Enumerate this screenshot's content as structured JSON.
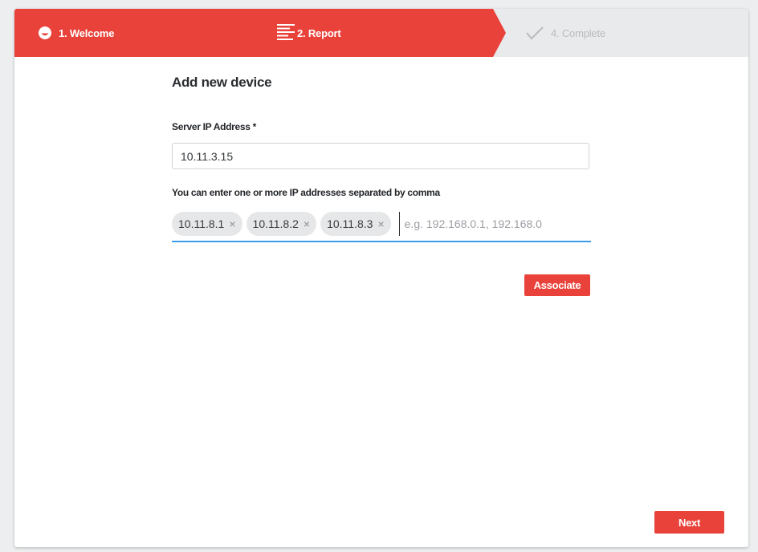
{
  "wizard": {
    "steps": [
      {
        "label": "1. Welcome",
        "icon": "smile-icon",
        "state": "done"
      },
      {
        "label": "2. Report",
        "icon": "list-lines-icon",
        "state": "active"
      },
      {
        "label": "4. Complete",
        "icon": "checkmark-icon",
        "state": "pending"
      }
    ],
    "active_color": "#e8423a",
    "inactive_color": "#e9eaeb"
  },
  "form": {
    "title": "Add new device",
    "server_ip_label": "Server IP Address *",
    "server_ip_value": "10.11.3.15",
    "multi_ip_label": "You can enter one or more IP addresses separated by comma",
    "ip_tags": [
      "10.11.8.1",
      "10.11.8.2",
      "10.11.8.3"
    ],
    "tag_remove_glyph": "×",
    "multi_ip_placeholder": "e.g. 192.168.0.1, 192.168.0",
    "associate_label": "Associate"
  },
  "footer": {
    "next_label": "Next"
  }
}
